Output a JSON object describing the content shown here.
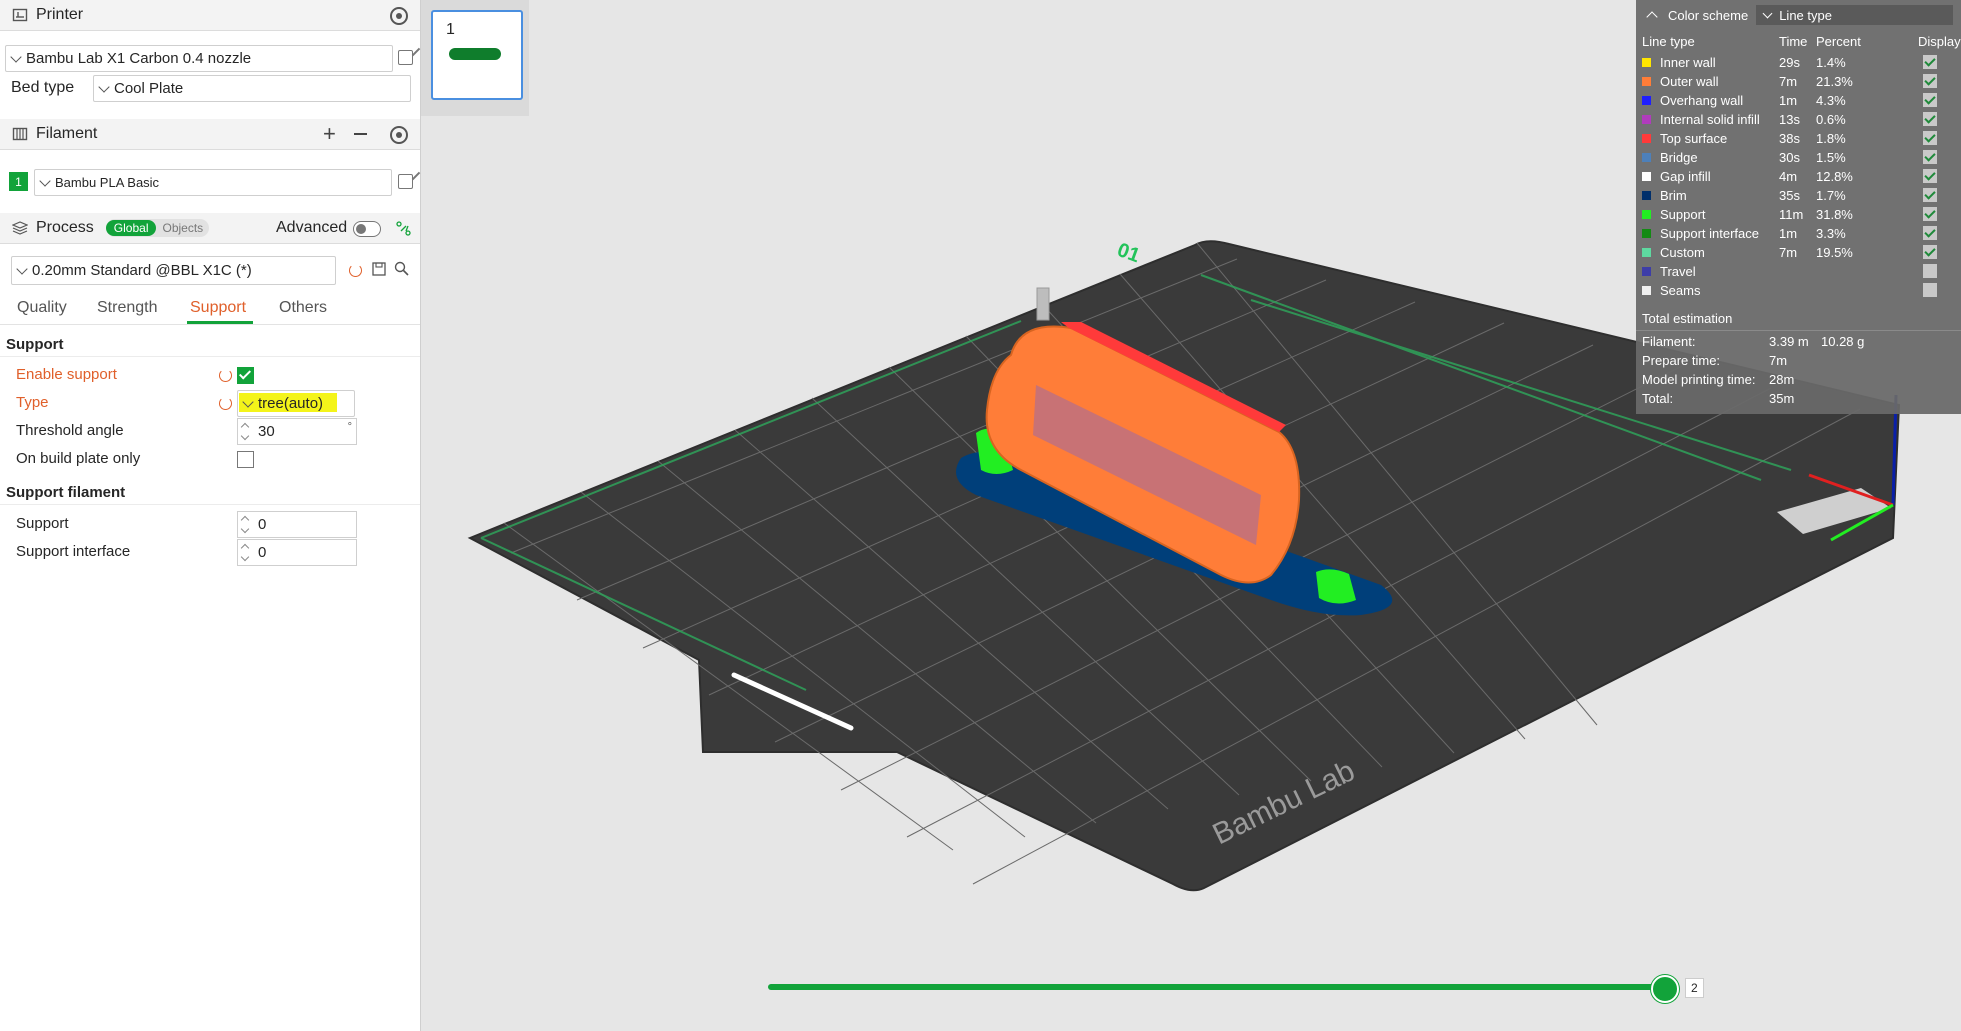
{
  "printer": {
    "title": "Printer",
    "preset": "Bambu Lab X1 Carbon 0.4 nozzle",
    "bed_type_label": "Bed type",
    "bed_type": "Cool Plate"
  },
  "filament": {
    "title": "Filament",
    "slot_number": "1",
    "name": "Bambu PLA Basic",
    "slot_color": "#12a33a"
  },
  "process": {
    "title": "Process",
    "scope_global": "Global",
    "scope_objects": "Objects",
    "advanced_label": "Advanced",
    "preset": "0.20mm Standard @BBL X1C (*)",
    "tabs": [
      "Quality",
      "Strength",
      "Support",
      "Others"
    ],
    "active_tab": "Support",
    "support_group": "Support",
    "enable_support_label": "Enable support",
    "type_label": "Type",
    "type_value": "tree(auto)",
    "threshold_label": "Threshold angle",
    "threshold_value": "30",
    "threshold_unit": "°",
    "build_plate_only_label": "On build plate only",
    "support_filament_group": "Support filament",
    "support_label": "Support",
    "support_value": "0",
    "support_interface_label": "Support interface",
    "support_interface_value": "0"
  },
  "plate": {
    "number": "1",
    "label_on_plate": "01",
    "brand": "Bambu Lab"
  },
  "legend": {
    "color_scheme_label": "Color scheme",
    "color_scheme_value": "Line type",
    "headers": [
      "Line type",
      "Time",
      "Percent",
      "Display"
    ],
    "total_label": "Total estimation",
    "filament_label": "Filament:",
    "filament_length": "3.39 m",
    "filament_weight": "10.28 g",
    "prepare_label": "Prepare time:",
    "prepare_value": "7m",
    "model_label": "Model printing time:",
    "model_value": "28m",
    "total_time_label": "Total:",
    "total_time_value": "35m"
  },
  "chart_data": {
    "type": "table",
    "columns": [
      "Line type",
      "Time",
      "Percent",
      "Display"
    ],
    "rows": [
      {
        "name": "Inner wall",
        "time": "29s",
        "percent": "1.4%",
        "display": true,
        "color": "#ffe600"
      },
      {
        "name": "Outer wall",
        "time": "7m",
        "percent": "21.3%",
        "display": true,
        "color": "#ff7d38"
      },
      {
        "name": "Overhang wall",
        "time": "1m",
        "percent": "4.3%",
        "display": true,
        "color": "#1f1fff"
      },
      {
        "name": "Internal solid infill",
        "time": "13s",
        "percent": "0.6%",
        "display": true,
        "color": "#b03cbc"
      },
      {
        "name": "Top surface",
        "time": "38s",
        "percent": "1.8%",
        "display": true,
        "color": "#ff3a3a"
      },
      {
        "name": "Bridge",
        "time": "30s",
        "percent": "1.5%",
        "display": true,
        "color": "#4d80ba"
      },
      {
        "name": "Gap infill",
        "time": "4m",
        "percent": "12.8%",
        "display": true,
        "color": "#ffffff"
      },
      {
        "name": "Brim",
        "time": "35s",
        "percent": "1.7%",
        "display": true,
        "color": "#002f6b"
      },
      {
        "name": "Support",
        "time": "11m",
        "percent": "31.8%",
        "display": true,
        "color": "#22ee22"
      },
      {
        "name": "Support interface",
        "time": "1m",
        "percent": "3.3%",
        "display": true,
        "color": "#138a13"
      },
      {
        "name": "Custom",
        "time": "7m",
        "percent": "19.5%",
        "display": true,
        "color": "#5ed9a0"
      },
      {
        "name": "Travel",
        "time": "",
        "percent": "",
        "display": false,
        "color": "#3d3da8"
      },
      {
        "name": "Seams",
        "time": "",
        "percent": "",
        "display": false,
        "color": "#f0f0f0"
      }
    ]
  },
  "layer_slider": {
    "current": "2",
    "fraction": 0.99,
    "color": "#12a33a"
  }
}
